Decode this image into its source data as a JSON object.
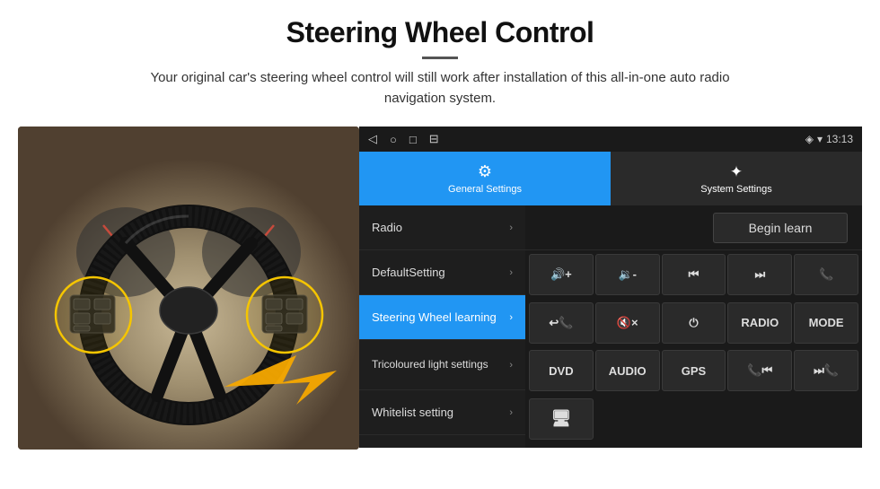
{
  "header": {
    "title": "Steering Wheel Control",
    "description": "Your original car's steering wheel control will still work after installation of this all-in-one auto radio navigation system."
  },
  "status_bar": {
    "time": "13:13",
    "icons": [
      "◁",
      "○",
      "□",
      "⊟"
    ]
  },
  "tabs": [
    {
      "id": "general",
      "label": "General Settings",
      "icon": "⚙",
      "active": true
    },
    {
      "id": "system",
      "label": "System Settings",
      "icon": "🌐",
      "active": false
    }
  ],
  "menu_items": [
    {
      "id": "radio",
      "label": "Radio",
      "active": false
    },
    {
      "id": "default",
      "label": "DefaultSetting",
      "active": false
    },
    {
      "id": "steering",
      "label": "Steering Wheel learning",
      "active": true
    },
    {
      "id": "tricoloured",
      "label": "Tricoloured light settings",
      "active": false
    },
    {
      "id": "whitelist",
      "label": "Whitelist setting",
      "active": false
    }
  ],
  "begin_learn_label": "Begin learn",
  "control_buttons": [
    {
      "id": "vol_up",
      "label": "🔊+",
      "text": "🔊+"
    },
    {
      "id": "vol_dn",
      "label": "🔉-",
      "text": "🔉-"
    },
    {
      "id": "prev",
      "label": "⏮",
      "text": "⏮"
    },
    {
      "id": "next",
      "label": "⏭",
      "text": "⏭"
    },
    {
      "id": "phone",
      "label": "📞",
      "text": "📞"
    },
    {
      "id": "call",
      "label": "📞↩",
      "text": "📞↩"
    },
    {
      "id": "mute",
      "label": "🔇",
      "text": "🔇×"
    },
    {
      "id": "power",
      "label": "⏻",
      "text": "⏻"
    },
    {
      "id": "radio_btn",
      "label": "RADIO",
      "text": "RADIO"
    },
    {
      "id": "mode",
      "label": "MODE",
      "text": "MODE"
    },
    {
      "id": "dvd",
      "label": "DVD",
      "text": "DVD"
    },
    {
      "id": "audio",
      "label": "AUDIO",
      "text": "AUDIO"
    },
    {
      "id": "gps",
      "label": "GPS",
      "text": "GPS"
    },
    {
      "id": "phone2",
      "label": "📞⏮",
      "text": "📞⏮"
    },
    {
      "id": "skip",
      "label": "⏭📞",
      "text": "⏭📞"
    }
  ],
  "last_row_btn": {
    "id": "settings_icon",
    "label": "⚙📋",
    "text": "🖳"
  }
}
